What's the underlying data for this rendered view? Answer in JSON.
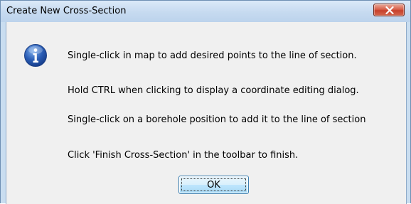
{
  "window": {
    "title": "Create New Cross-Section",
    "close_icon": "close-x-icon"
  },
  "dialog": {
    "icon": "information-icon",
    "messages": [
      "Single-click in map to add desired points to the line of section.",
      "Hold CTRL when clicking to display a coordinate editing dialog.",
      "Single-click on a borehole position to add it to the line of section",
      "Click 'Finish Cross-Section' in the toolbar to finish."
    ],
    "ok_label": "OK"
  },
  "colors": {
    "title_bar": "#c6daf0",
    "close_button": "#c7412c",
    "client_background": "#f0f0f0",
    "info_icon_blue": "#2a5db5"
  }
}
